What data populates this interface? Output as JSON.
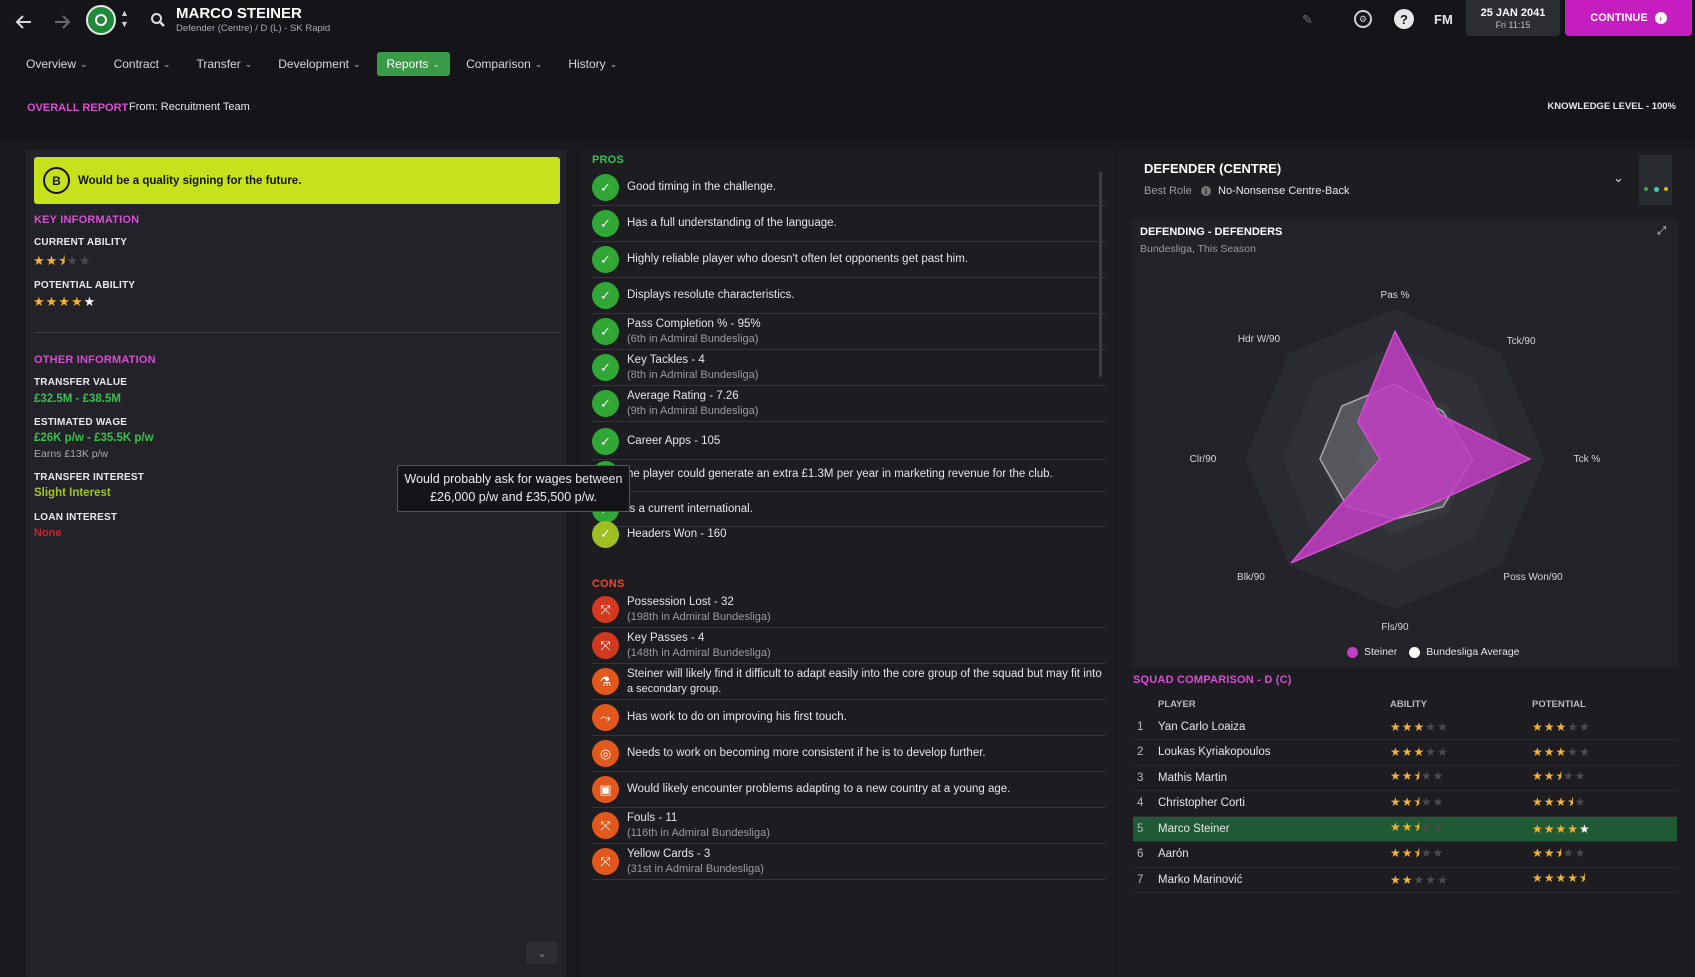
{
  "header": {
    "player_name": "MARCO STEINER",
    "subtitle": "Defender (Centre) / D (L) - SK Rapid",
    "back_icon": "arrow-left-icon",
    "forward_icon": "arrow-right-icon",
    "club_badge_icon": "club-badge-icon",
    "search_icon": "search-icon",
    "fm_label": "FM",
    "date": "25 JAN 2041",
    "time": "Fri 11:15",
    "continue_label": "CONTINUE",
    "accent": "#c51dbf"
  },
  "nav": {
    "tabs": [
      "Overview",
      "Contract",
      "Transfer",
      "Development",
      "Reports",
      "Comparison",
      "History"
    ],
    "active": "Reports"
  },
  "report": {
    "title": "OVERALL REPORT",
    "from": "From: Recruitment Team",
    "knowledge": "KNOWLEDGE LEVEL - 100%"
  },
  "left": {
    "grade": "B",
    "verdict": "Would be a quality signing for the future.",
    "key_info_title": "KEY INFORMATION",
    "current_ability_label": "CURRENT ABILITY",
    "current_ability_stars": 2.5,
    "potential_ability_label": "POTENTIAL ABILITY",
    "potential_ability_stars": 5,
    "other_info_title": "OTHER INFORMATION",
    "transfer_value_label": "TRANSFER VALUE",
    "transfer_value": "£32.5M - £38.5M",
    "estimated_wage_label": "ESTIMATED WAGE",
    "estimated_wage": "£26K p/w - £35.5K p/w",
    "earns": "Earns £13K p/w",
    "transfer_interest_label": "TRANSFER INTEREST",
    "transfer_interest": "Slight Interest",
    "loan_interest_label": "LOAN INTEREST",
    "loan_interest": "None",
    "tooltip_line1": "Would probably ask for wages between",
    "tooltip_line2": "£26,000 p/w and £35,500 p/w."
  },
  "pros": {
    "title": "PROS",
    "items": [
      {
        "text": "Good timing in the challenge.",
        "sub": ""
      },
      {
        "text": "Has a full understanding of the language.",
        "sub": ""
      },
      {
        "text": "Highly reliable player who doesn't often let opponents get past him.",
        "sub": ""
      },
      {
        "text": "Displays resolute characteristics.",
        "sub": ""
      },
      {
        "text": "Pass Completion % - 95%",
        "sub": "(6th in Admiral Bundesliga)"
      },
      {
        "text": "Key Tackles - 4",
        "sub": "(8th in Admiral Bundesliga)"
      },
      {
        "text": "Average Rating - 7.26",
        "sub": "(9th in Admiral Bundesliga)"
      },
      {
        "text": "Career Apps - 105",
        "sub": ""
      },
      {
        "text": "he player could generate an extra £1.3M per year in marketing revenue for the club.",
        "sub": ""
      },
      {
        "text": "is a current international.",
        "sub": ""
      },
      {
        "text": "Headers Won - 160",
        "sub": ""
      }
    ]
  },
  "cons": {
    "title": "CONS",
    "items": [
      {
        "text": "Possession Lost - 32",
        "sub": "(198th in Admiral Bundesliga)"
      },
      {
        "text": "Key Passes - 4",
        "sub": "(148th in Admiral Bundesliga)"
      },
      {
        "text": "Steiner will likely find it difficult to adapt easily into the core group of the squad but may fit into",
        "sub": "a secondary group."
      },
      {
        "text": "Has work to do on improving his first touch.",
        "sub": ""
      },
      {
        "text": "Needs to work on becoming more consistent if he is to develop further.",
        "sub": ""
      },
      {
        "text": "Would likely encounter problems adapting to a new country at a young age.",
        "sub": ""
      },
      {
        "text": "Fouls - 11",
        "sub": "(116th in Admiral Bundesliga)"
      },
      {
        "text": "Yellow Cards - 3",
        "sub": "(31st in Admiral Bundesliga)"
      }
    ]
  },
  "right": {
    "position": "DEFENDER (CENTRE)",
    "best_role_label": "Best Role",
    "best_role": "No-Nonsense Centre-Back",
    "chart_title": "DEFENDING - DEFENDERS",
    "chart_subtitle": "Bundesliga, This Season",
    "legend_steiner": "Steiner",
    "legend_avg": "Bundesliga Average",
    "squad_title": "SQUAD COMPARISON - D (C)",
    "col_player": "PLAYER",
    "col_ability": "ABILITY",
    "col_potential": "POTENTIAL"
  },
  "chart_data": {
    "type": "radar",
    "categories": [
      "Pas %",
      "Tck/90",
      "Tck %",
      "Poss Won/90",
      "Fls/90",
      "Blk/90",
      "Clr/90",
      "Hdr W/90"
    ],
    "series": [
      {
        "name": "Steiner",
        "color": "#c33ec6",
        "values": [
          0.85,
          0.42,
          0.9,
          0.4,
          0.4,
          0.98,
          0.1,
          0.35
        ]
      },
      {
        "name": "Bundesliga Average",
        "color": "#ffffff",
        "values": [
          0.5,
          0.45,
          0.52,
          0.45,
          0.4,
          0.45,
          0.5,
          0.5
        ]
      }
    ],
    "ring_count": 4
  },
  "squad": [
    {
      "n": "1",
      "name": "Yan Carlo Loaiza",
      "ability": 3,
      "potential": 3
    },
    {
      "n": "2",
      "name": "Loukas Kyriakopoulos",
      "ability": 3,
      "potential": 3
    },
    {
      "n": "3",
      "name": "Mathis Martin",
      "ability": 2.5,
      "potential": 2.5
    },
    {
      "n": "4",
      "name": "Christopher Corti",
      "ability": 2.5,
      "potential": 3.5
    },
    {
      "n": "5",
      "name": "Marco Steiner",
      "ability": 2.5,
      "potential": 5,
      "selected": true
    },
    {
      "n": "6",
      "name": "Aarón",
      "ability": 2.5,
      "potential": 2.5
    },
    {
      "n": "7",
      "name": "Marko Marinović",
      "ability": 2,
      "potential": 4.5
    }
  ]
}
